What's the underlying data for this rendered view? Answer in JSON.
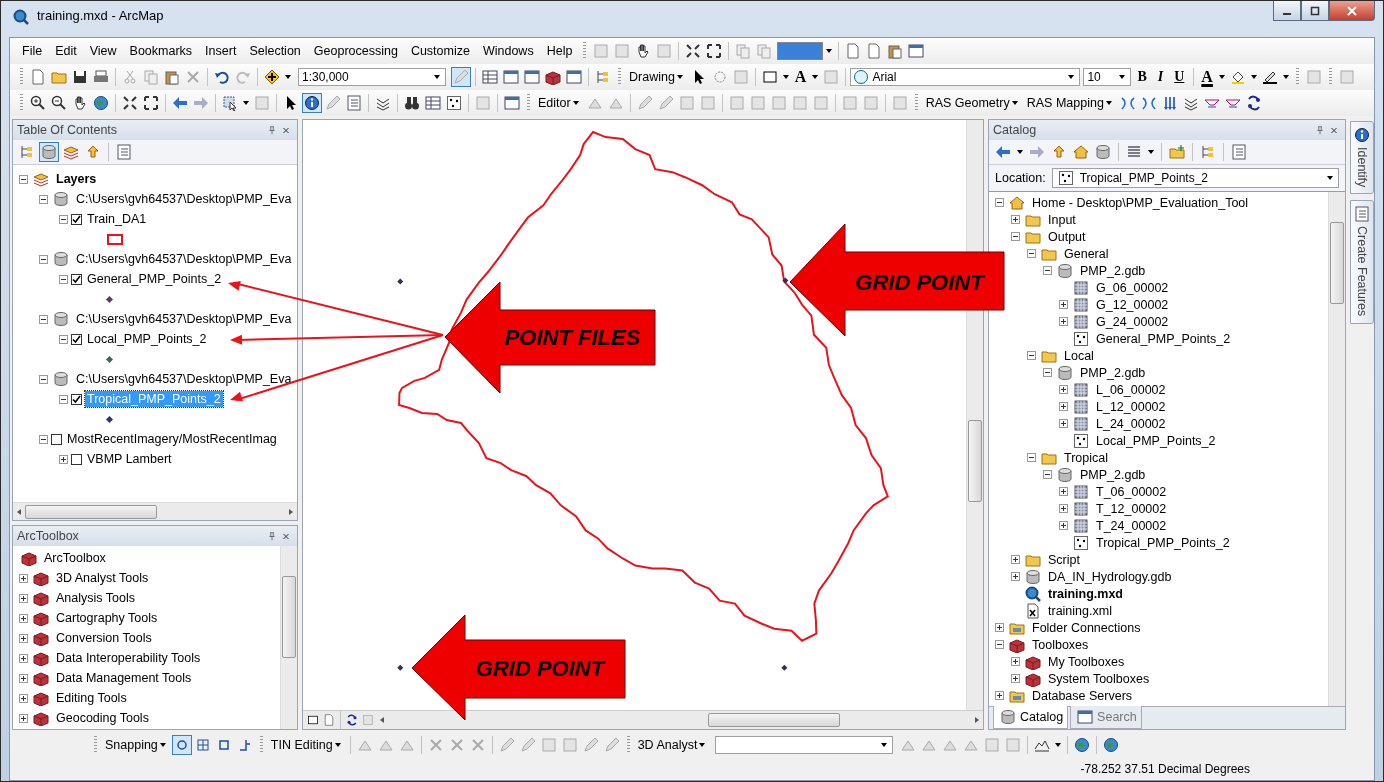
{
  "window": {
    "title": "training.mxd - ArcMap"
  },
  "menu": [
    "File",
    "Edit",
    "View",
    "Bookmarks",
    "Insert",
    "Selection",
    "Geoprocessing",
    "Customize",
    "Windows",
    "Help"
  ],
  "toolbar": {
    "scale": "1:30,000",
    "editing_pressed": true,
    "drawing_menu": "Drawing",
    "text_tool": "A",
    "font": "Arial",
    "font_size": "10",
    "format_buttons": [
      "B",
      "I",
      "U"
    ],
    "font_color_button": "A",
    "identify_pressed": true,
    "editor_menu": "Editor",
    "ras_geometry_menu": "RAS Geometry",
    "ras_mapping_menu": "RAS Mapping"
  },
  "toc": {
    "title": "Table Of Contents",
    "items": [
      {
        "label": "Layers",
        "kind": "group",
        "expanded": true,
        "children": [
          {
            "label": "C:\\Users\\gvh64537\\Desktop\\PMP_Eva",
            "kind": "source",
            "expanded": true,
            "children": [
              {
                "label": "Train_DA1",
                "kind": "layer",
                "expanded": true,
                "checked": true,
                "selected": false,
                "children": [
                  {
                    "kind": "polygon",
                    "color": "#e8141c"
                  }
                ]
              }
            ]
          },
          {
            "label": "C:\\Users\\gvh64537\\Desktop\\PMP_Eva",
            "kind": "source",
            "expanded": true,
            "children": [
              {
                "label": "General_PMP_Points_2",
                "kind": "layer",
                "expanded": true,
                "checked": true,
                "selected": false,
                "children": [
                  {
                    "kind": "point",
                    "color": "#5a3a6a"
                  }
                ]
              }
            ]
          },
          {
            "label": "C:\\Users\\gvh64537\\Desktop\\PMP_Eva",
            "kind": "source",
            "expanded": true,
            "children": [
              {
                "label": "Local_PMP_Points_2",
                "kind": "layer",
                "expanded": true,
                "checked": true,
                "selected": false,
                "children": [
                  {
                    "kind": "point",
                    "color": "#3a6a5a"
                  }
                ]
              }
            ]
          },
          {
            "label": "C:\\Users\\gvh64537\\Desktop\\PMP_Eva",
            "kind": "source",
            "expanded": true,
            "children": [
              {
                "label": "Tropical_PMP_Points_2",
                "kind": "layer",
                "expanded": true,
                "checked": true,
                "selected": true,
                "children": [
                  {
                    "kind": "point",
                    "color": "#2a3a6a"
                  }
                ]
              }
            ]
          },
          {
            "label": "MostRecentImagery/MostRecentImag",
            "kind": "layer",
            "expanded": true,
            "checked": false,
            "selected": false,
            "children": [
              {
                "label": "VBMP Lambert",
                "kind": "layer",
                "expanded": false,
                "checked": false,
                "selected": false
              }
            ]
          }
        ]
      }
    ]
  },
  "arctoolbox": {
    "title": "ArcToolbox",
    "root": "ArcToolbox",
    "items": [
      {
        "label": "3D Analyst Tools",
        "expanded": false
      },
      {
        "label": "Analysis Tools",
        "expanded": false
      },
      {
        "label": "Cartography Tools",
        "expanded": false
      },
      {
        "label": "Conversion Tools",
        "expanded": false
      },
      {
        "label": "Data Interoperability Tools",
        "expanded": false
      },
      {
        "label": "Data Management Tools",
        "expanded": false
      },
      {
        "label": "Editing Tools",
        "expanded": false
      },
      {
        "label": "Geocoding Tools",
        "expanded": false
      }
    ]
  },
  "map": {
    "callouts": [
      {
        "text": "GRID POINT"
      },
      {
        "text": "POINT FILES"
      },
      {
        "text": "GRID POINT"
      }
    ]
  },
  "catalog": {
    "title": "Catalog",
    "location_label": "Location:",
    "location": "Tropical_PMP_Points_2",
    "tree": [
      {
        "label": "Home - Desktop\\PMP_Evaluation_Tool",
        "kind": "home",
        "expanded": true,
        "children": [
          {
            "label": "Input",
            "kind": "folder",
            "expanded": false
          },
          {
            "label": "Output",
            "kind": "folder",
            "expanded": true,
            "children": [
              {
                "label": "General",
                "kind": "folder",
                "expanded": true,
                "children": [
                  {
                    "label": "PMP_2.gdb",
                    "kind": "gdb",
                    "expanded": true,
                    "children": [
                      {
                        "label": "G_06_00002",
                        "kind": "raster"
                      },
                      {
                        "label": "G_12_00002",
                        "kind": "raster",
                        "expanded": false
                      },
                      {
                        "label": "G_24_00002",
                        "kind": "raster",
                        "expanded": false
                      },
                      {
                        "label": "General_PMP_Points_2",
                        "kind": "points"
                      }
                    ]
                  }
                ]
              },
              {
                "label": "Local",
                "kind": "folder",
                "expanded": true,
                "children": [
                  {
                    "label": "PMP_2.gdb",
                    "kind": "gdb",
                    "expanded": true,
                    "children": [
                      {
                        "label": "L_06_00002",
                        "kind": "raster",
                        "expanded": false
                      },
                      {
                        "label": "L_12_00002",
                        "kind": "raster",
                        "expanded": false
                      },
                      {
                        "label": "L_24_00002",
                        "kind": "raster",
                        "expanded": false
                      },
                      {
                        "label": "Local_PMP_Points_2",
                        "kind": "points"
                      }
                    ]
                  }
                ]
              },
              {
                "label": "Tropical",
                "kind": "folder",
                "expanded": true,
                "children": [
                  {
                    "label": "PMP_2.gdb",
                    "kind": "gdb",
                    "expanded": true,
                    "children": [
                      {
                        "label": "T_06_00002",
                        "kind": "raster",
                        "expanded": false
                      },
                      {
                        "label": "T_12_00002",
                        "kind": "raster",
                        "expanded": false
                      },
                      {
                        "label": "T_24_00002",
                        "kind": "raster",
                        "expanded": false
                      },
                      {
                        "label": "Tropical_PMP_Points_2",
                        "kind": "points"
                      }
                    ]
                  }
                ]
              }
            ]
          },
          {
            "label": "Script",
            "kind": "folder",
            "expanded": false
          },
          {
            "label": "DA_IN_Hydrology.gdb",
            "kind": "gdb",
            "expanded": false
          },
          {
            "label": "training.mxd",
            "kind": "mxd"
          },
          {
            "label": "training.xml",
            "kind": "xml"
          }
        ]
      },
      {
        "label": "Folder Connections",
        "kind": "connections",
        "expanded": false
      },
      {
        "label": "Toolboxes",
        "kind": "toolboxes",
        "expanded": true,
        "children": [
          {
            "label": "My Toolboxes",
            "kind": "toolboxes",
            "expanded": false
          },
          {
            "label": "System Toolboxes",
            "kind": "toolboxes",
            "expanded": false
          }
        ]
      },
      {
        "label": "Database Servers",
        "kind": "servers",
        "expanded": false
      }
    ],
    "tabs": [
      {
        "label": "Catalog",
        "selected": true
      },
      {
        "label": "Search",
        "selected": false
      }
    ]
  },
  "side_tabs": [
    "Identify",
    "Create Features"
  ],
  "bottom_toolbar": {
    "snapping_menu": "Snapping",
    "tin_editing_menu": "TIN Editing",
    "analyst_menu": "3D Analyst"
  },
  "status_bar": {
    "coordinates": "-78.252  37.51 Decimal Degrees"
  }
}
